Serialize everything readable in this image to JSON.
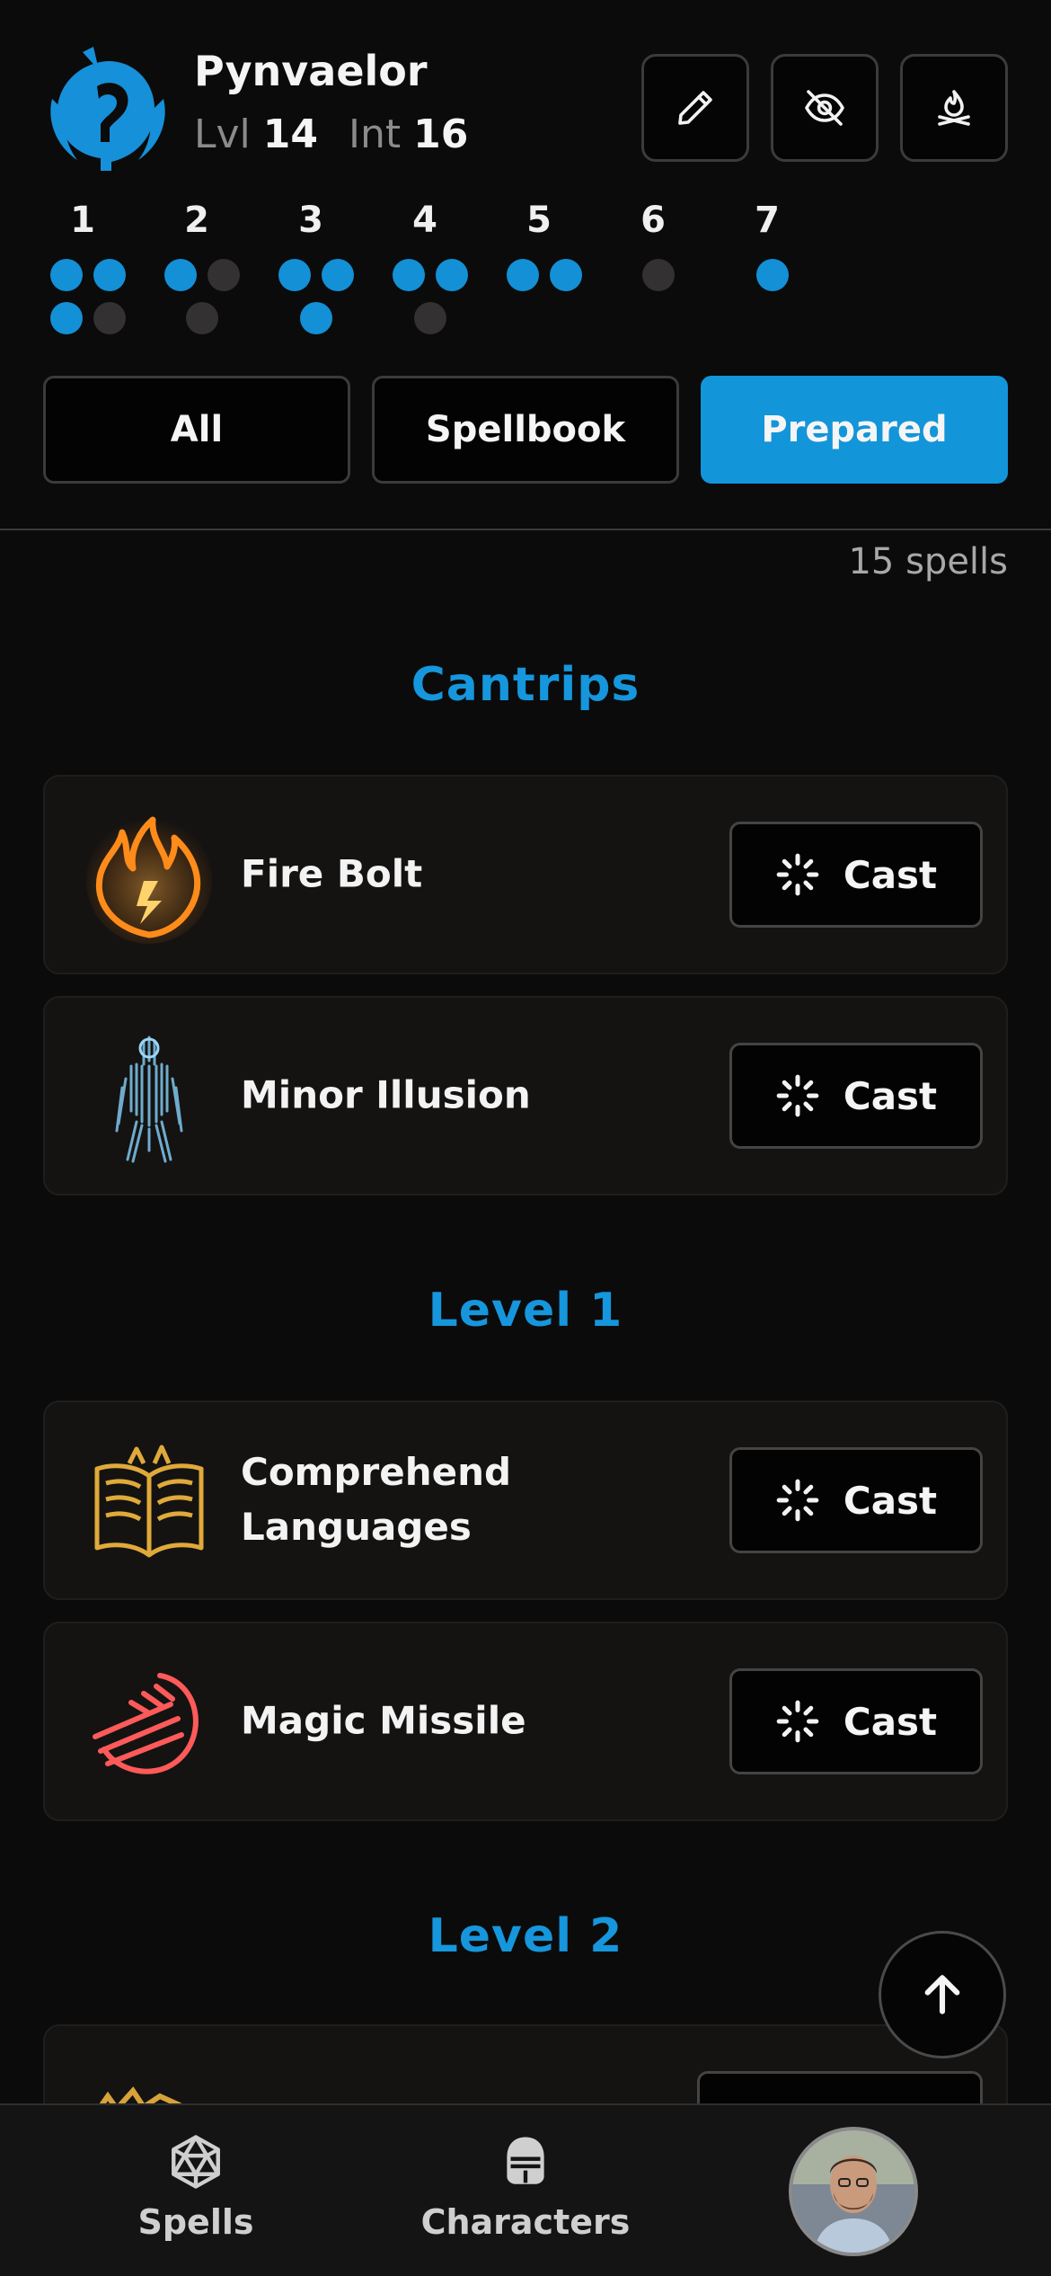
{
  "character": {
    "name": "Pynvaelor",
    "level_label": "Lvl",
    "level": "14",
    "int_label": "Int",
    "int": "16"
  },
  "header_actions": [
    {
      "icon": "pencil-icon"
    },
    {
      "icon": "eye-off-icon"
    },
    {
      "icon": "campfire-icon"
    }
  ],
  "spell_slots": [
    {
      "level": "1",
      "total": 4,
      "available": 3
    },
    {
      "level": "2",
      "total": 3,
      "available": 1
    },
    {
      "level": "3",
      "total": 3,
      "available": 3
    },
    {
      "level": "4",
      "total": 3,
      "available": 2
    },
    {
      "level": "5",
      "total": 2,
      "available": 2
    },
    {
      "level": "6",
      "total": 1,
      "available": 0
    },
    {
      "level": "7",
      "total": 1,
      "available": 1
    }
  ],
  "filters": {
    "all": "All",
    "spellbook": "Spellbook",
    "prepared": "Prepared",
    "active": "Prepared"
  },
  "spell_count": "15 spells",
  "sections": {
    "cantrips": "Cantrips",
    "level1": "Level 1",
    "level2": "Level 2"
  },
  "spells": {
    "fire_bolt": "Fire Bolt",
    "minor_illusion": "Minor Illusion",
    "comprehend_languages": "Comprehend Languages",
    "magic_missile": "Magic Missile"
  },
  "cast_label": "Cast",
  "colors": {
    "accent": "#1395d9",
    "slot_available": "#1390d6",
    "slot_used": "#333131"
  },
  "tabbar": {
    "spells": "Spells",
    "characters": "Characters"
  }
}
